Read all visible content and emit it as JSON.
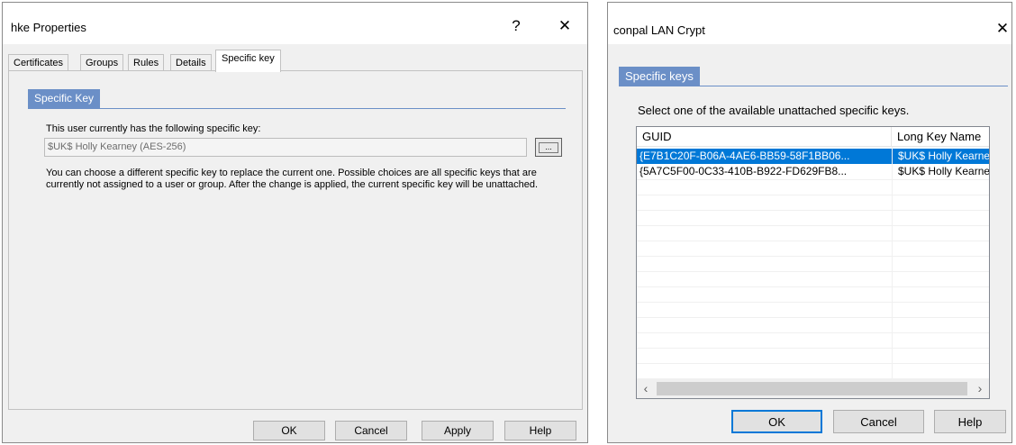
{
  "left_window": {
    "title": "hke Properties",
    "help_glyph": "?",
    "close_glyph": "✕",
    "tabs": [
      {
        "label": "Certificates"
      },
      {
        "label": "Groups"
      },
      {
        "label": "Rules"
      },
      {
        "label": "Details"
      },
      {
        "label": "Specific key"
      }
    ],
    "group_title": "Specific Key",
    "current_key_label": "This user currently has the following specific key:",
    "current_key_value": "$UK$ Holly Kearney (AES-256)",
    "browse_label": "...",
    "description": "You can choose a different specific key to replace the current one. Possible choices are all specific keys that are currently not assigned to a user or group. After the change is applied, the current specific key will be unattached.",
    "buttons": {
      "ok": "OK",
      "cancel": "Cancel",
      "apply": "Apply",
      "help": "Help"
    }
  },
  "right_window": {
    "title": "conpal LAN Crypt",
    "close_glyph": "✕",
    "group_title": "Specific keys",
    "instruction": "Select one of the available unattached specific keys.",
    "columns": [
      "GUID",
      "Long Key Name"
    ],
    "rows": [
      {
        "guid": "{E7B1C20F-B06A-4AE6-BB59-58F1BB06...",
        "name": "$UK$ Holly Kearney",
        "selected": true
      },
      {
        "guid": "{5A7C5F00-0C33-410B-B922-FD629FB8...",
        "name": "$UK$ Holly Kearney",
        "selected": false
      }
    ],
    "scroll_left": "‹",
    "scroll_right": "›",
    "buttons": {
      "ok": "OK",
      "cancel": "Cancel",
      "help": "Help"
    }
  },
  "colors": {
    "group_header": "#6b8fc7",
    "selection": "#0078d7",
    "default_button_border": "#0078d7"
  }
}
